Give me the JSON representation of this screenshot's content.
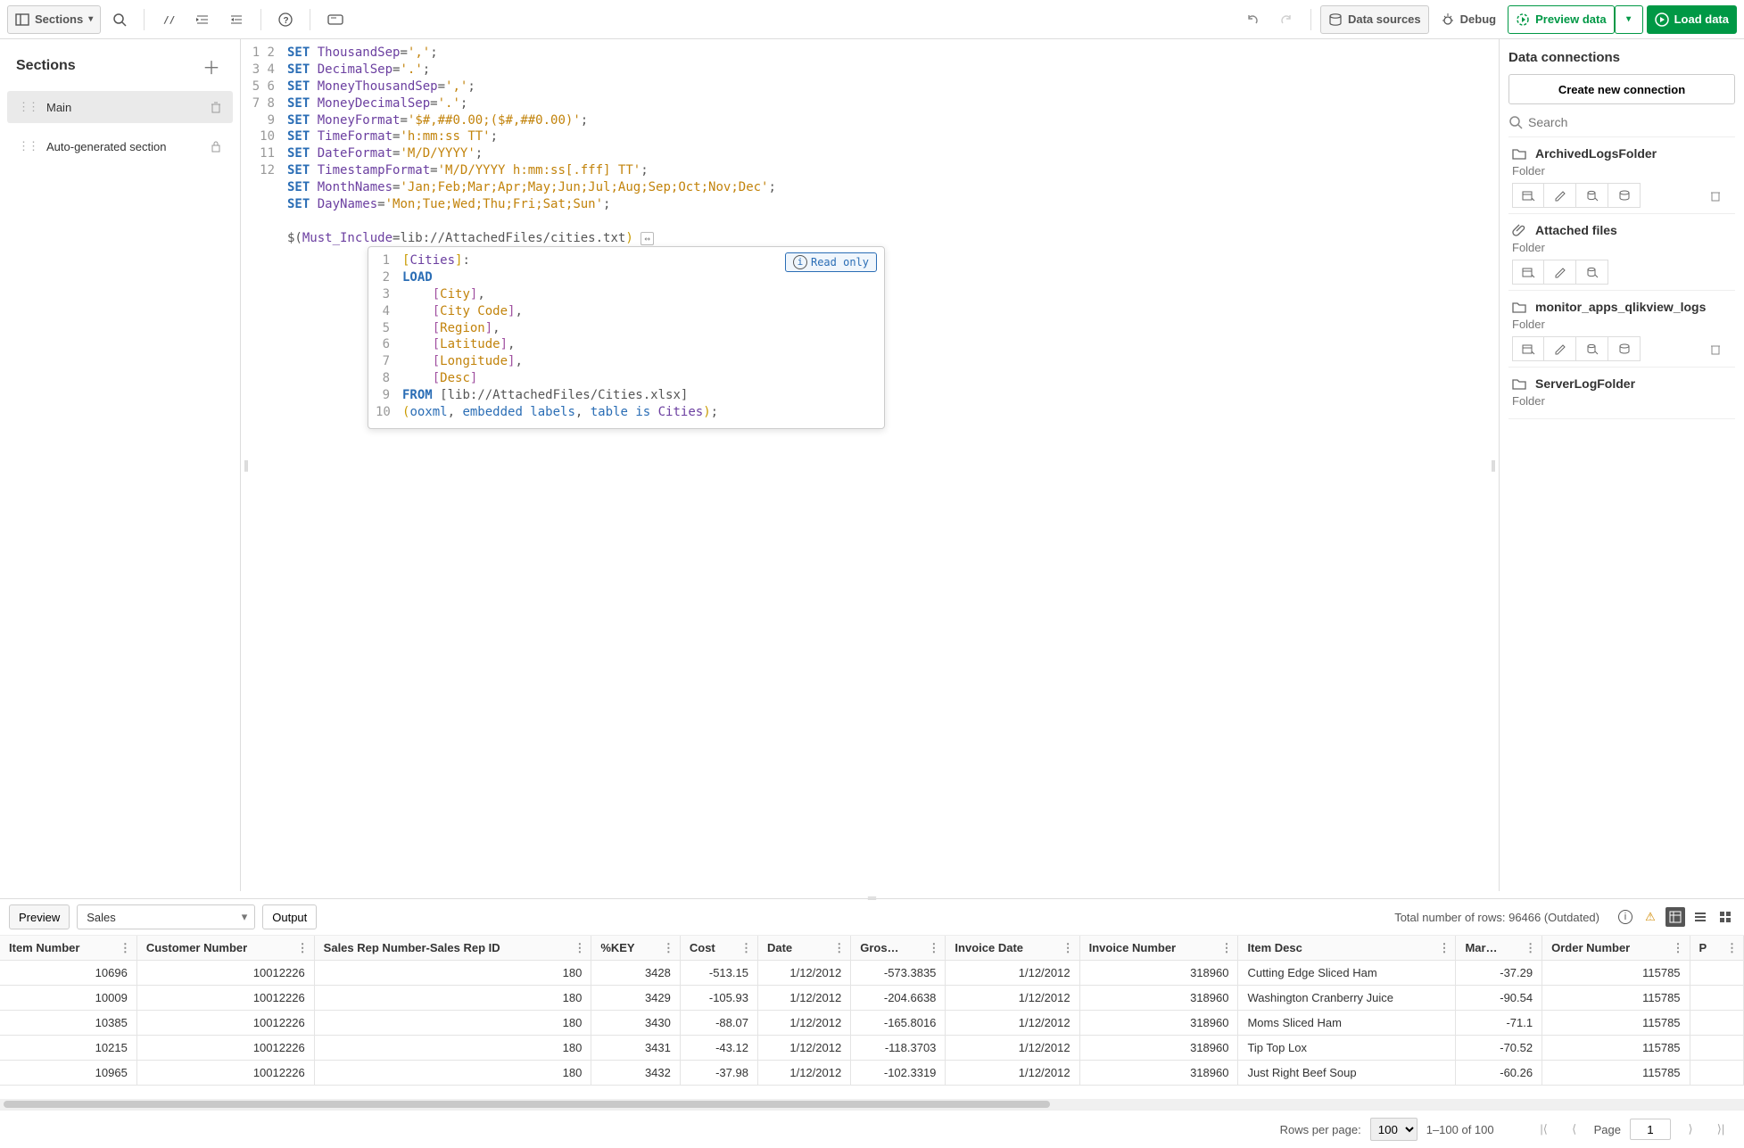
{
  "toolbar": {
    "sections_label": "Sections",
    "data_sources_label": "Data sources",
    "debug_label": "Debug",
    "preview_data_label": "Preview data",
    "load_data_label": "Load data"
  },
  "sections": {
    "title": "Sections",
    "items": [
      {
        "label": "Main",
        "active": true,
        "deletable": true
      },
      {
        "label": "Auto-generated section",
        "active": false,
        "locked": true
      }
    ]
  },
  "script": {
    "lines": [
      {
        "n": 1,
        "kw": "SET",
        "var": "ThousandSep",
        "str": "','"
      },
      {
        "n": 2,
        "kw": "SET",
        "var": "DecimalSep",
        "str": "'.'"
      },
      {
        "n": 3,
        "kw": "SET",
        "var": "MoneyThousandSep",
        "str": "','"
      },
      {
        "n": 4,
        "kw": "SET",
        "var": "MoneyDecimalSep",
        "str": "'.'"
      },
      {
        "n": 5,
        "kw": "SET",
        "var": "MoneyFormat",
        "str": "'$#,##0.00;($#,##0.00)'"
      },
      {
        "n": 6,
        "kw": "SET",
        "var": "TimeFormat",
        "str": "'h:mm:ss TT'"
      },
      {
        "n": 7,
        "kw": "SET",
        "var": "DateFormat",
        "str": "'M/D/YYYY'"
      },
      {
        "n": 8,
        "kw": "SET",
        "var": "TimestampFormat",
        "str": "'M/D/YYYY h:mm:ss[.fff] TT'"
      },
      {
        "n": 9,
        "kw": "SET",
        "var": "MonthNames",
        "str": "'Jan;Feb;Mar;Apr;May;Jun;Jul;Aug;Sep;Oct;Nov;Dec'"
      },
      {
        "n": 10,
        "kw": "SET",
        "var": "DayNames",
        "str": "'Mon;Tue;Wed;Thu;Fri;Sat;Sun'"
      }
    ],
    "include_prefix": "$(",
    "include_var": "Must_Include",
    "include_eq": "=",
    "include_path": "lib://AttachedFiles/cities.txt",
    "include_suffix": ")",
    "embedded": {
      "readonly_label": "Read only",
      "table_name": "Cities",
      "load_kw": "LOAD",
      "fields": [
        "City",
        "City Code",
        "Region",
        "Latitude",
        "Longitude",
        "Desc"
      ],
      "from_kw": "FROM",
      "from_path": "[lib://AttachedFiles/Cities.xlsx]",
      "opts_open": "(",
      "opts_kw1": "ooxml",
      "opts_kw2": "embedded labels",
      "opts_kw3": "table is",
      "opts_tbl": "Cities",
      "opts_close": ");"
    }
  },
  "connections": {
    "title": "Data connections",
    "create_label": "Create new connection",
    "search_placeholder": "Search",
    "items": [
      {
        "name": "ArchivedLogsFolder",
        "type": "Folder",
        "icon": "folder",
        "actions": 4,
        "trash": true
      },
      {
        "name": "Attached files",
        "type": "Folder",
        "icon": "clip",
        "actions": 3,
        "trash": false
      },
      {
        "name": "monitor_apps_qlikview_logs",
        "type": "Folder",
        "icon": "folder",
        "actions": 4,
        "trash": true
      },
      {
        "name": "ServerLogFolder",
        "type": "Folder",
        "icon": "folder",
        "actions": 0,
        "trash": false
      }
    ]
  },
  "preview": {
    "preview_label": "Preview",
    "output_label": "Output",
    "selected_table": "Sales",
    "total_rows": "Total number of rows: 96466 (Outdated)",
    "columns": [
      "Item Number",
      "Customer Number",
      "Sales Rep Number-Sales Rep ID",
      "%KEY",
      "Cost",
      "Date",
      "Gros…",
      "Invoice Date",
      "Invoice Number",
      "Item Desc",
      "Mar…",
      "Order Number",
      "P"
    ],
    "rows": [
      [
        "10696",
        "10012226",
        "180",
        "3428",
        "-513.15",
        "1/12/2012",
        "-573.3835",
        "1/12/2012",
        "318960",
        "Cutting Edge Sliced Ham",
        "-37.29",
        "115785",
        ""
      ],
      [
        "10009",
        "10012226",
        "180",
        "3429",
        "-105.93",
        "1/12/2012",
        "-204.6638",
        "1/12/2012",
        "318960",
        "Washington Cranberry Juice",
        "-90.54",
        "115785",
        ""
      ],
      [
        "10385",
        "10012226",
        "180",
        "3430",
        "-88.07",
        "1/12/2012",
        "-165.8016",
        "1/12/2012",
        "318960",
        "Moms Sliced Ham",
        "-71.1",
        "115785",
        ""
      ],
      [
        "10215",
        "10012226",
        "180",
        "3431",
        "-43.12",
        "1/12/2012",
        "-118.3703",
        "1/12/2012",
        "318960",
        "Tip Top Lox",
        "-70.52",
        "115785",
        ""
      ],
      [
        "10965",
        "10012226",
        "180",
        "3432",
        "-37.98",
        "1/12/2012",
        "-102.3319",
        "1/12/2012",
        "318960",
        "Just Right Beef Soup",
        "-60.26",
        "115785",
        ""
      ]
    ],
    "pager": {
      "rows_per_page_label": "Rows per page:",
      "rows_per_page_value": "100",
      "range": "1–100 of 100",
      "page_label": "Page",
      "page_value": "1"
    }
  }
}
